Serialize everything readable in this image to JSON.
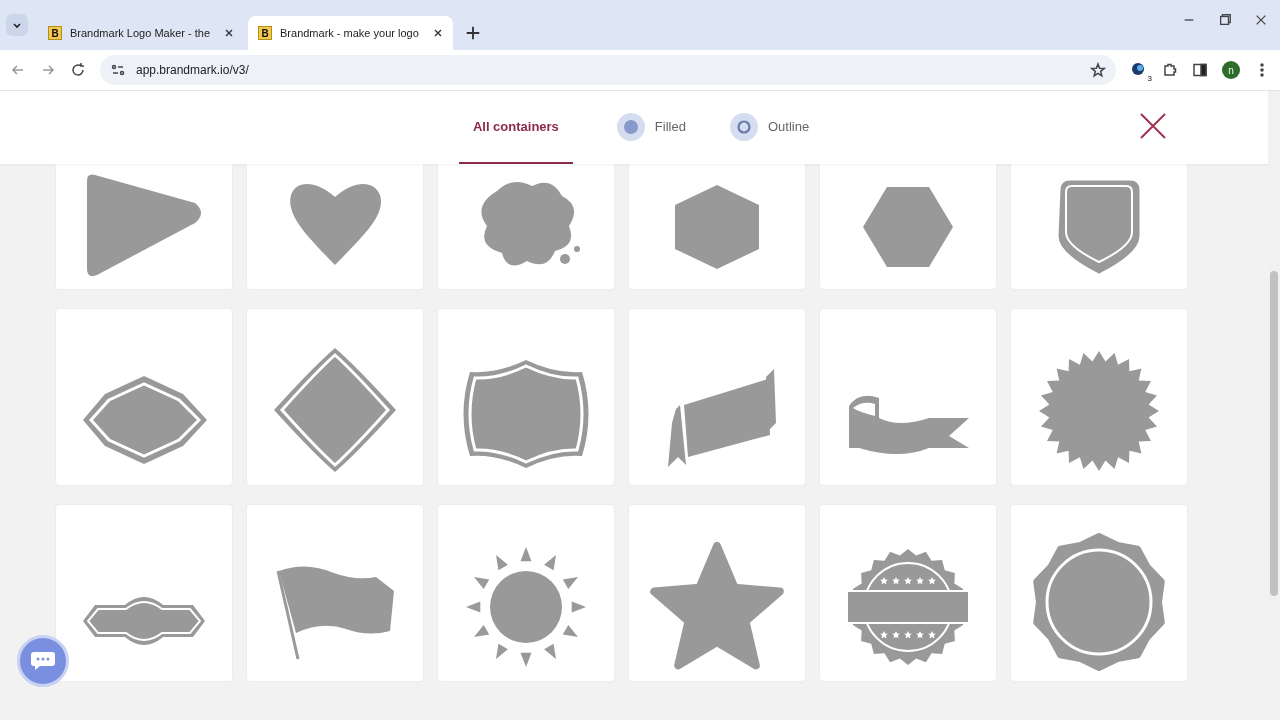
{
  "browser": {
    "tabs": [
      {
        "favicon_letter": "B",
        "title": "Brandmark Logo Maker - the",
        "selected": false
      },
      {
        "favicon_letter": "B",
        "title": "Brandmark - make your logo",
        "selected": true
      }
    ],
    "url": "app.brandmark.io/v3/",
    "extension_badge": "3",
    "profile_letter": "n"
  },
  "filters": [
    {
      "label": "All containers",
      "kind": "text",
      "selected": true
    },
    {
      "label": "Filled",
      "kind": "filled",
      "selected": false
    },
    {
      "label": "Outline",
      "kind": "outline",
      "selected": false
    }
  ],
  "containers": [
    {
      "kind": "play"
    },
    {
      "kind": "heart"
    },
    {
      "kind": "splash"
    },
    {
      "kind": "hexagon"
    },
    {
      "kind": "hexagon-flat"
    },
    {
      "kind": "shield"
    },
    {
      "kind": "badge"
    },
    {
      "kind": "diamond"
    },
    {
      "kind": "cushion"
    },
    {
      "kind": "banner"
    },
    {
      "kind": "ribbon"
    },
    {
      "kind": "burst"
    },
    {
      "kind": "label"
    },
    {
      "kind": "flag"
    },
    {
      "kind": "sun"
    },
    {
      "kind": "star"
    },
    {
      "kind": "seal"
    },
    {
      "kind": "scallop"
    }
  ]
}
